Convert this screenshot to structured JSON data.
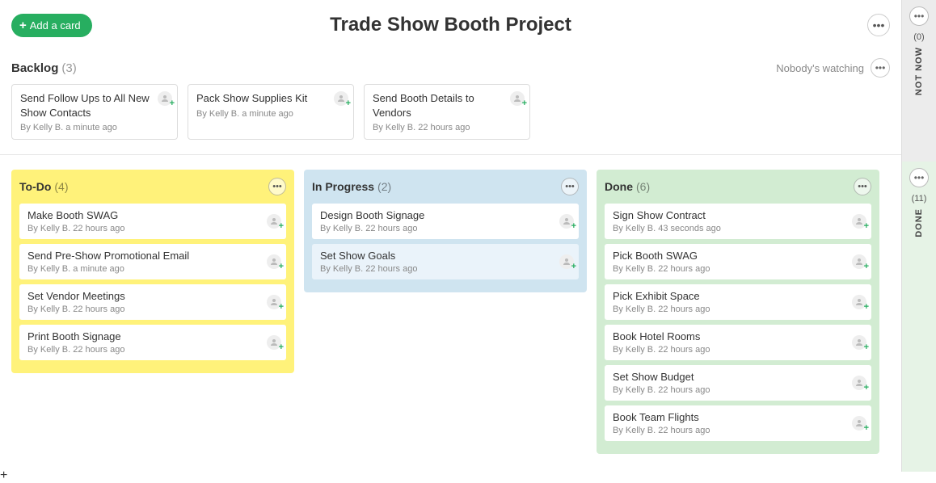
{
  "header": {
    "add_card": "Add a card",
    "title": "Trade Show Booth Project"
  },
  "backlog": {
    "title": "Backlog",
    "count": "(3)",
    "watching": "Nobody's watching",
    "cards": [
      {
        "title": "Send Follow Ups to All New Show Contacts",
        "meta": "By Kelly B. a minute ago"
      },
      {
        "title": "Pack Show Supplies Kit",
        "meta": "By Kelly B. a minute ago"
      },
      {
        "title": "Send Booth Details to Vendors",
        "meta": "By Kelly B. 22 hours ago"
      }
    ]
  },
  "columns": {
    "todo": {
      "title": "To-Do",
      "count": "(4)",
      "cards": [
        {
          "title": "Make Booth SWAG",
          "meta": "By Kelly B. 22 hours ago"
        },
        {
          "title": "Send Pre-Show Promotional Email",
          "meta": "By Kelly B. a minute ago"
        },
        {
          "title": "Set Vendor Meetings",
          "meta": "By Kelly B. 22 hours ago"
        },
        {
          "title": "Print Booth Signage",
          "meta": "By Kelly B. 22 hours ago"
        }
      ]
    },
    "progress": {
      "title": "In Progress",
      "count": "(2)",
      "cards": [
        {
          "title": "Design Booth Signage",
          "meta": "By Kelly B. 22 hours ago"
        },
        {
          "title": "Set Show Goals",
          "meta": "By Kelly B. 22 hours ago"
        }
      ]
    },
    "done": {
      "title": "Done",
      "count": "(6)",
      "cards": [
        {
          "title": "Sign Show Contract",
          "meta": "By Kelly B. 43 seconds ago"
        },
        {
          "title": "Pick Booth SWAG",
          "meta": "By Kelly B. 22 hours ago"
        },
        {
          "title": "Pick Exhibit Space",
          "meta": "By Kelly B. 22 hours ago"
        },
        {
          "title": "Book Hotel Rooms",
          "meta": "By Kelly B. 22 hours ago"
        },
        {
          "title": "Set Show Budget",
          "meta": "By Kelly B. 22 hours ago"
        },
        {
          "title": "Book Team Flights",
          "meta": "By Kelly B. 22 hours ago"
        }
      ]
    }
  },
  "rail": {
    "notnow": {
      "count": "(0)",
      "label": "NOT NOW"
    },
    "done": {
      "count": "(11)",
      "label": "DONE"
    }
  }
}
